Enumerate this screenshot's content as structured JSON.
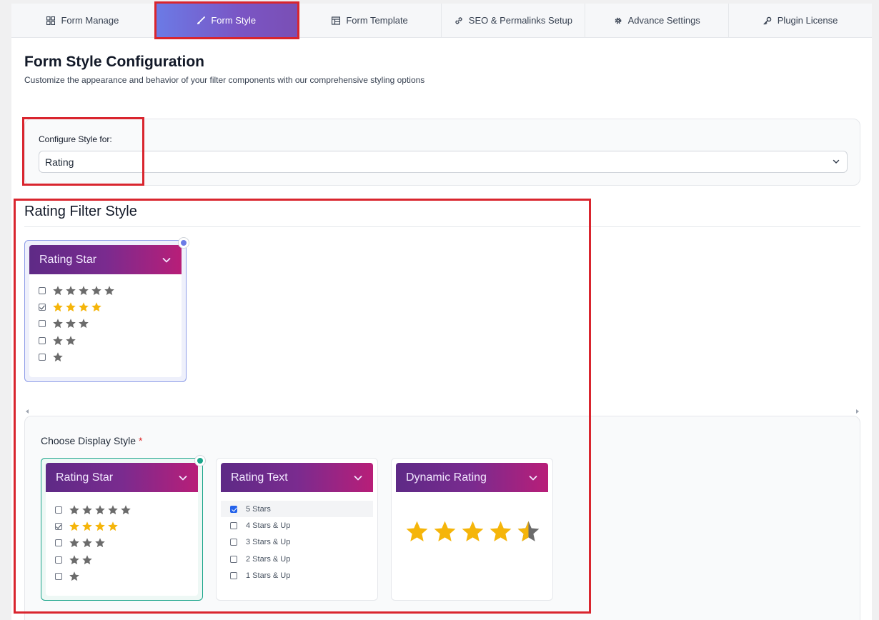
{
  "tabs": [
    {
      "label": "Form Manage",
      "icon": "grid-icon"
    },
    {
      "label": "Form Style",
      "icon": "brush-icon"
    },
    {
      "label": "Form Template",
      "icon": "template-icon"
    },
    {
      "label": "SEO & Permalinks Setup",
      "icon": "link-icon"
    },
    {
      "label": "Advance Settings",
      "icon": "gear-icon"
    },
    {
      "label": "Plugin License",
      "icon": "key-icon"
    }
  ],
  "active_tab": "Form Style",
  "header": {
    "title": "Form Style Configuration",
    "subtitle": "Customize the appearance and behavior of your filter components with our comprehensive styling options"
  },
  "config": {
    "label": "Configure Style for:",
    "selected": "Rating"
  },
  "section": {
    "title": "Rating Filter Style"
  },
  "filter_style_card": {
    "title": "Rating Star",
    "rows": [
      {
        "stars": 5,
        "checked": false,
        "color": "#6b6b6b"
      },
      {
        "stars": 4,
        "checked": true,
        "color": "#f5b50a"
      },
      {
        "stars": 3,
        "checked": false,
        "color": "#6b6b6b"
      },
      {
        "stars": 2,
        "checked": false,
        "color": "#6b6b6b"
      },
      {
        "stars": 1,
        "checked": false,
        "color": "#6b6b6b"
      }
    ]
  },
  "display": {
    "label": "Choose Display Style",
    "required_mark": "*",
    "options": [
      {
        "title": "Rating Star"
      },
      {
        "title": "Rating Text",
        "items": [
          "5 Stars",
          "4 Stars & Up",
          "3 Stars & Up",
          "2 Stars & Up",
          "1 Stars & Up"
        ]
      },
      {
        "title": "Dynamic Rating",
        "stars": 4.5
      }
    ]
  },
  "colors": {
    "accent": "#6b7be6",
    "selected_green": "#1aa58a",
    "star_gold": "#f5b50a",
    "star_gray": "#6b6b6b",
    "annotation_red": "#d9252e"
  }
}
